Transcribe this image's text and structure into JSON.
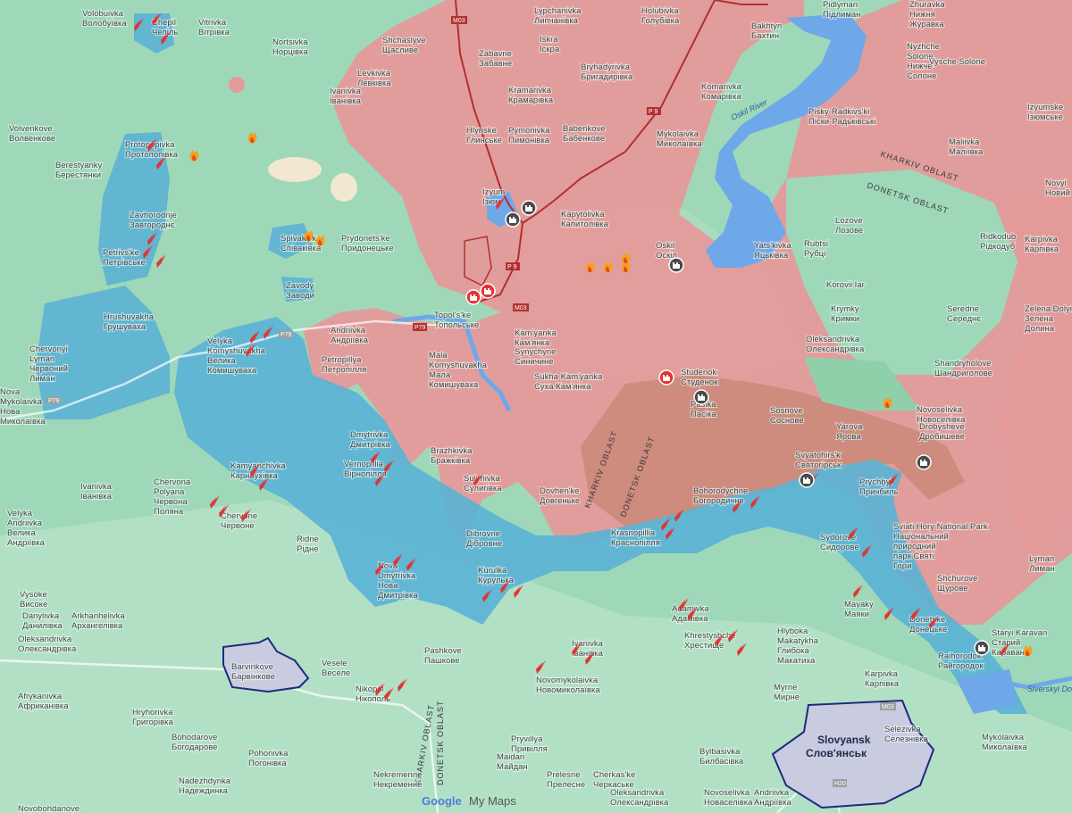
{
  "colors": {
    "green_bg": "#9ed8b8",
    "occupied": "#e59a9a",
    "occupied_dark": "#c98a78",
    "contested": "#5bb3d5",
    "water": "#6fa8e8",
    "road": "#c33a3a",
    "city": "#c9cbe0",
    "city_border": "#1e2a80"
  },
  "cities": [
    {
      "name": "Volobuivka\nВолобуївка"
    },
    {
      "name": "Chepil\nЧепіль"
    },
    {
      "name": "Vitrivka\nВітрівка"
    },
    {
      "name": "Nortsivka\nНорцівка"
    },
    {
      "name": "Shchaslyve\nЩасливе"
    },
    {
      "name": "Lypchanivka\nЛипчанівка"
    },
    {
      "name": "Holubivka\nГолубівка"
    },
    {
      "name": "Bakhtyn\nБахтин"
    },
    {
      "name": "Pidlyman\nПідлиман"
    },
    {
      "name": "Zhuravka\nНижня\nЖуравка"
    },
    {
      "name": "Levkivka\nЛевківка"
    },
    {
      "name": "Iskra\nІскра"
    },
    {
      "name": "Zabavne\nЗабавне"
    },
    {
      "name": "Bryhadyrivka\nБригадирівка"
    },
    {
      "name": "Nyzhche\nSolone\nНижче\nСолоне"
    },
    {
      "name": "Ivanivka\nІванівка"
    },
    {
      "name": "Kramarivka\nКрамарівка"
    },
    {
      "name": "Komarivka\nКомарівка"
    },
    {
      "name": "Vysche Solone"
    },
    {
      "name": "Volvenkove\nВолвенкове"
    },
    {
      "name": "Babenkove\nБабенкове"
    },
    {
      "name": "Pisky-Radkivs'ki\nПіски-Радьківські"
    },
    {
      "name": "Izyumske\nІзюмське"
    },
    {
      "name": "Hlynske\nГлинське"
    },
    {
      "name": "Pymonivka\nПимонівка"
    },
    {
      "name": "Mykolaivka\nМиколаївка"
    },
    {
      "name": "Protopopivka\nПротопопівка"
    },
    {
      "name": "Berestyanky\nБерестянки"
    },
    {
      "name": "Maliivka\nМаліївка"
    },
    {
      "name": "Novyi\nНовий"
    },
    {
      "name": "Zavhorodnje\nЗавгороднє"
    },
    {
      "name": "Izyum\nІзюм"
    },
    {
      "name": "Kapytolivka\nКапитолівка"
    },
    {
      "name": "Lozove\nЛозове"
    },
    {
      "name": "Spivakivka\nСпіваківка"
    },
    {
      "name": "Prydonets'ke\nПридонецьке"
    },
    {
      "name": "Oskil\nОскіл"
    },
    {
      "name": "Yats'kivka\nЯцьківка"
    },
    {
      "name": "Rubtsi\nРубці"
    },
    {
      "name": "Ridkodub\nРідкодуб"
    },
    {
      "name": "Petrivs'ke\nПетрівське"
    },
    {
      "name": "Karpivka\nКарпівка"
    },
    {
      "name": "Zavody\nЗаводи"
    },
    {
      "name": "Korovii Iar"
    },
    {
      "name": "Topol's'ke\nТопольське"
    },
    {
      "name": "Krymky\nКримки"
    },
    {
      "name": "Seredne\nСереднє"
    },
    {
      "name": "Zelena Dolyna\nЗелена\nДолина"
    },
    {
      "name": "Chervonyi\nLyman\nЧервоний\nЛиман"
    },
    {
      "name": "Hrushuvakha\nГрушуваха"
    },
    {
      "name": "Andriivka\nАндріївка"
    },
    {
      "name": "Kam'yanka\nКам'янка"
    },
    {
      "name": "Velyka\nKomyshuvakha\nВелика\nКомишуваха"
    },
    {
      "name": "Petropillya\nПетропілля"
    },
    {
      "name": "Mala\nKomyshuvakha\nМала\nКомишуваха"
    },
    {
      "name": "Synychyne\nСиничине"
    },
    {
      "name": "Oleksandrivka\nОлександрівка"
    },
    {
      "name": "Shandryholove\nШандриголове"
    },
    {
      "name": "Nova\nMykolaivka\nНова\nМиколаївка"
    },
    {
      "name": "Sukha Kam'yanka\nСуха Кам'янка"
    },
    {
      "name": "Studenok\nСтуденок"
    },
    {
      "name": "Pasika\nПасіка"
    },
    {
      "name": "Novoselivka\nНовоселівка"
    },
    {
      "name": "Sosnove\nСоснове"
    },
    {
      "name": "Yarova\nЯрова"
    },
    {
      "name": "Drobysheve\nДробишеве"
    },
    {
      "name": "Dmytrivka\nДмитрівка"
    },
    {
      "name": "Brazhkivka\nБражківка"
    },
    {
      "name": "Svyatohirs'k\nСвятогірськ"
    },
    {
      "name": "Kamyanchivka\nКарнаухівка"
    },
    {
      "name": "Vernopillia\nВірнопілля"
    },
    {
      "name": "Sulyhivka\nСулигівка"
    },
    {
      "name": "Dovhen'ke\nДовгеньке"
    },
    {
      "name": "Bohorodychne\nБогородичне"
    },
    {
      "name": "Prychbyl\nПричбиль"
    },
    {
      "name": "Chervona\nPolyana\nЧервона\nПоляна"
    },
    {
      "name": "Ivanivka\nІванівка"
    },
    {
      "name": "Velyka\nAndriivka\nВелика\nАндріївка"
    },
    {
      "name": "Chervone\nЧервоне"
    },
    {
      "name": "Sviati Hory National Park\nНаціональний\nприродний\nпарк Святі\nГори"
    },
    {
      "name": "Lyman\nЛиман"
    },
    {
      "name": "Dibrovne\nДібровне"
    },
    {
      "name": "Krasnopillia\nКраснопілля"
    },
    {
      "name": "Sydorove\nСидорове"
    },
    {
      "name": "Ridne\nРідне"
    },
    {
      "name": "Nova\nDmytrivka\nНова\nДмитрівка"
    },
    {
      "name": "Kurulka\nКурулька"
    },
    {
      "name": "Shchurove\nЩурове"
    },
    {
      "name": "Vysoke\nВисоке"
    },
    {
      "name": "Danylivka\nДанилівка"
    },
    {
      "name": "Arkhanhelivka\nАрхангелівка"
    },
    {
      "name": "Adamivka\nАдамівка"
    },
    {
      "name": "Mayaky\nМаяки"
    },
    {
      "name": "Donetske\nДонецьке"
    },
    {
      "name": "Staryi Karavan\nСтарий\nКараван"
    },
    {
      "name": "Oleksandrivka\nОлександрівка"
    },
    {
      "name": "Ivanivka\nІванівка"
    },
    {
      "name": "Khrestyshche\nХрестище"
    },
    {
      "name": "Barvinkove\nБарвінкове"
    },
    {
      "name": "Pashkove\nПашкове"
    },
    {
      "name": "Hlyboka\nMakatykha\nГлибока\nМакатиха"
    },
    {
      "name": "Raihorodok\nРайгородок"
    },
    {
      "name": "Vesele\nВеселе"
    },
    {
      "name": "Afrykanivka\nАфриканівка"
    },
    {
      "name": "Nikopol\nНікополь"
    },
    {
      "name": "Novomykolaivka\nНовомиколаївка"
    },
    {
      "name": "Karpivka\nКарпівка"
    },
    {
      "name": "Myrne\nМирне"
    },
    {
      "name": "Hryhorivka\nГригорівка"
    },
    {
      "name": "Selezivka\nСелезнівка"
    },
    {
      "name": "Mykolaivka\nМиколаївка"
    },
    {
      "name": "Bohodarove\nБогодарове"
    },
    {
      "name": "Pryvillya\nПривілля"
    },
    {
      "name": "Maidan\nМайдан"
    },
    {
      "name": "Prelesne\nПрелесне"
    },
    {
      "name": "Bylbasivka\nБилбасівка"
    },
    {
      "name": "Pohonivka\nПогонівка"
    },
    {
      "name": "Cherkas'ke\nЧеркаське"
    },
    {
      "name": "Nadezhdynka\nНадеждинка"
    },
    {
      "name": "Nekremenne\nНекременне"
    },
    {
      "name": "Oleksandrivka\nОлександрівка"
    },
    {
      "name": "Novoselivka\nНоваселівка"
    },
    {
      "name": "Andriivka\nАндріївка"
    },
    {
      "name": "Novobohdanove"
    }
  ],
  "major_city": {
    "name": "Slovyansk",
    "name_local": "Слов'янськ"
  },
  "oblast_labels": [
    "KHARKIV OBLAST",
    "DONETSK OBLAST",
    "KHARKIV OBLAST",
    "DONETSK OBLAST",
    "DONETSK OBLAST",
    "KHARKIV OBLAST"
  ],
  "river_labels": [
    "Oskil River",
    "Siverskyi Do"
  ],
  "road_shields": [
    "M03",
    "P 9",
    "P79",
    "P79",
    "P 9",
    "M03",
    "M03",
    "H20",
    "P79"
  ],
  "branding": {
    "google": "Google",
    "my_maps": "My Maps"
  },
  "icon_types": [
    "explosion-marker",
    "fire-marker",
    "fortification-marker",
    "hq-marker"
  ]
}
